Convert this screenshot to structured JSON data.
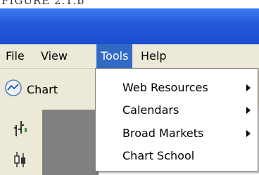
{
  "caption": "FIGURE 2.1.b",
  "colors": {
    "titlebar": "#2358d8",
    "menu_bg": "#ece9d8",
    "highlight": "#316ac5",
    "canvas": "#808080"
  },
  "menubar": {
    "items": [
      {
        "label": "File"
      },
      {
        "label": "View"
      },
      {
        "label": "Tools",
        "active": true
      },
      {
        "label": "Help"
      }
    ]
  },
  "toolbar": {
    "chart_label": "Chart",
    "chart_icon": "chart-icon"
  },
  "left_tools": [
    {
      "icon": "bar-chart-icon"
    },
    {
      "icon": "candlestick-icon"
    }
  ],
  "tools_menu": {
    "items": [
      {
        "label": "Web Resources",
        "submenu": true
      },
      {
        "label": "Calendars",
        "submenu": true
      },
      {
        "label": "Broad Markets",
        "submenu": true
      },
      {
        "label": "Chart School",
        "submenu": false
      }
    ]
  }
}
